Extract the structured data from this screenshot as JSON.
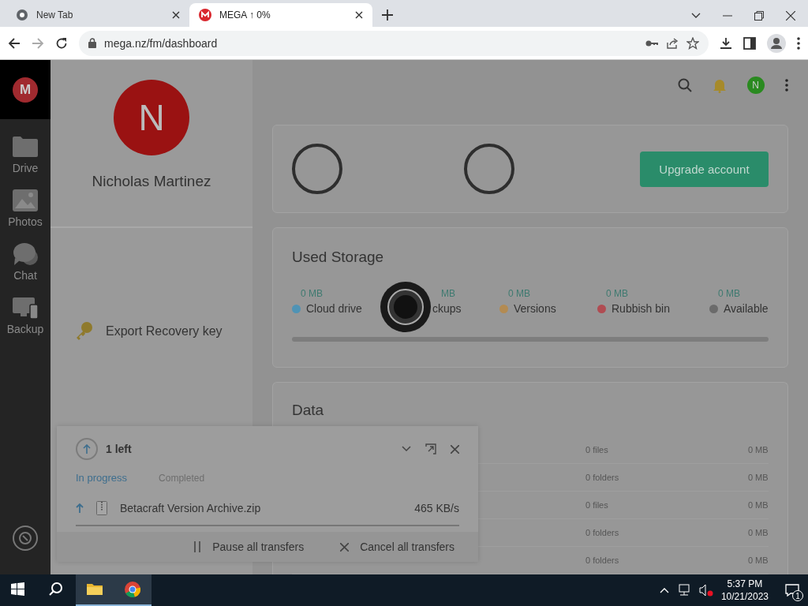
{
  "browser": {
    "tabs": [
      {
        "title": "New Tab",
        "kind": "chrome",
        "selected": false
      },
      {
        "title": "MEGA ↑ 0%",
        "kind": "mega",
        "selected": true
      }
    ],
    "address": "mega.nz/fm/dashboard"
  },
  "sidebar": {
    "logo": "M",
    "items": [
      {
        "label": "Drive",
        "kind": "drive"
      },
      {
        "label": "Photos",
        "kind": "photos"
      },
      {
        "label": "Chat",
        "kind": "chat"
      },
      {
        "label": "Backup",
        "kind": "backup"
      }
    ]
  },
  "profile": {
    "initial": "N",
    "name": "Nicholas Martinez",
    "action": "Export Recovery key"
  },
  "header": {
    "avatar_initial": "N"
  },
  "upgrade_button": "Upgrade account",
  "storage": {
    "title": "Used Storage",
    "level": 0,
    "items": [
      {
        "value": "0 MB",
        "label": "Cloud drive",
        "color": "#4f93b5"
      },
      {
        "value": "MB",
        "label": "ckups"
      },
      {
        "value": "0 MB",
        "label": "Versions",
        "color": "#b38b52"
      },
      {
        "value": "0 MB",
        "label": "Rubbish bin",
        "color": "#b04c52"
      },
      {
        "value": "0 MB",
        "label": "Available",
        "color": "#6b6b6b"
      }
    ]
  },
  "data": {
    "title": "Data",
    "rows": [
      {
        "count": "0 files",
        "size": "0 MB"
      },
      {
        "count": "0 folders",
        "size": "0 MB"
      },
      {
        "count": "0 files",
        "size": "0 MB"
      },
      {
        "count": "0 folders",
        "size": "0 MB"
      },
      {
        "count": "0 folders",
        "size": "0 MB"
      }
    ]
  },
  "transfers": {
    "summary": "1 left",
    "tabs": [
      {
        "label": "In progress",
        "selected": true
      },
      {
        "label": "Completed",
        "selected": false
      }
    ],
    "items": [
      {
        "name": "Betacraft Version Archive.zip",
        "speed": "465 KB/s"
      }
    ],
    "actions": [
      {
        "label": "Pause all transfers",
        "kind": "pause"
      },
      {
        "label": "Cancel all transfers",
        "kind": "cancel"
      }
    ]
  },
  "taskbar": {
    "time": "5:37 PM",
    "date": "10/21/2023",
    "notifications": "1"
  }
}
